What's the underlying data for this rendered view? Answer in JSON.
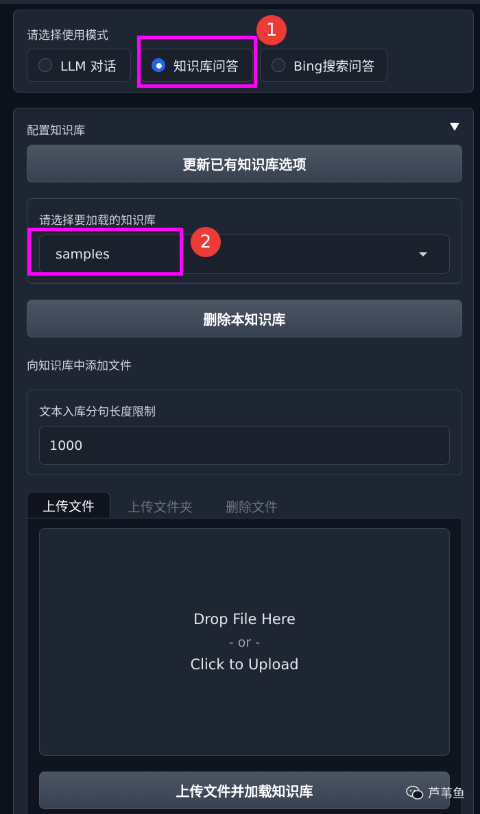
{
  "mode": {
    "label": "请选择使用模式",
    "options": [
      {
        "label": "LLM 对话",
        "selected": false
      },
      {
        "label": "知识库问答",
        "selected": true
      },
      {
        "label": "Bing搜索问答",
        "selected": false
      }
    ]
  },
  "annotations": {
    "marker1": "1",
    "marker2": "2",
    "highlight_color": "#ff00ff",
    "marker_color": "#ef3b36"
  },
  "kb": {
    "section_title": "配置知识库",
    "collapse_icon": "triangle-down-icon",
    "refresh_button": "更新已有知识库选项",
    "select_label": "请选择要加载的知识库",
    "select_value": "samples",
    "delete_button": "删除本知识库",
    "add_files_label": "向知识库中添加文件",
    "sentence_limit_label": "文本入库分句长度限制",
    "sentence_limit_value": "1000",
    "tabs": [
      "上传文件",
      "上传文件夹",
      "删除文件"
    ],
    "upload": {
      "line1": "Drop File Here",
      "line2": "- or -",
      "line3": "Click to Upload"
    },
    "upload_button": "上传文件并加载知识库"
  },
  "watermark": {
    "text": "芦苇鱼",
    "icon": "wechat-icon"
  },
  "colors": {
    "background": "#0c111c",
    "panel": "#1f2633",
    "accent": "#2563eb"
  }
}
